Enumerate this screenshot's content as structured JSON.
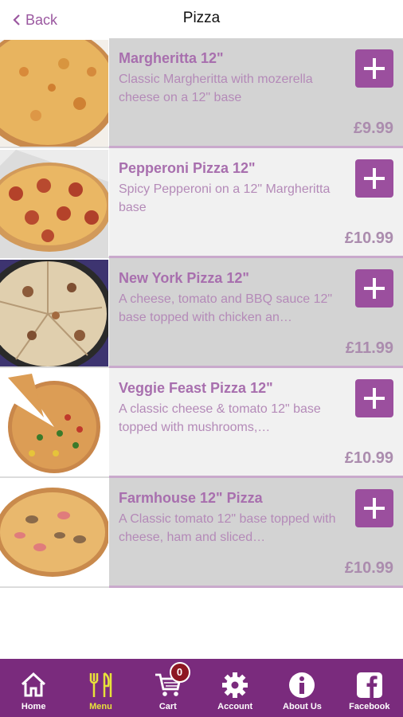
{
  "header": {
    "back_label": "Back",
    "title": "Pizza"
  },
  "items": [
    {
      "name": "Margheritta 12\"",
      "desc": "Classic Margheritta with mozerella cheese on a 12\" base",
      "price": "£9.99"
    },
    {
      "name": "Pepperoni Pizza 12\"",
      "desc": "Spicy Pepperoni on a 12\" Margheritta base",
      "price": "£10.99"
    },
    {
      "name": "New York Pizza 12\"",
      "desc": "A cheese, tomato and BBQ sauce 12\" base topped with chicken an…",
      "price": "£11.99"
    },
    {
      "name": "Veggie Feast Pizza 12\"",
      "desc": "A classic cheese & tomato 12\" base topped with mushrooms,…",
      "price": "£10.99"
    },
    {
      "name": "Farmhouse 12\" Pizza",
      "desc": "A Classic tomato 12\" base topped with cheese, ham and sliced…",
      "price": "£10.99"
    }
  ],
  "tabbar": {
    "home": "Home",
    "menu": "Menu",
    "cart": "Cart",
    "cart_count": "0",
    "account": "Account",
    "about": "About Us",
    "facebook": "Facebook"
  },
  "colors": {
    "brand_purple": "#7a2b7d",
    "accent_button": "#9b4f9e",
    "active_tab": "#e7e23a"
  }
}
